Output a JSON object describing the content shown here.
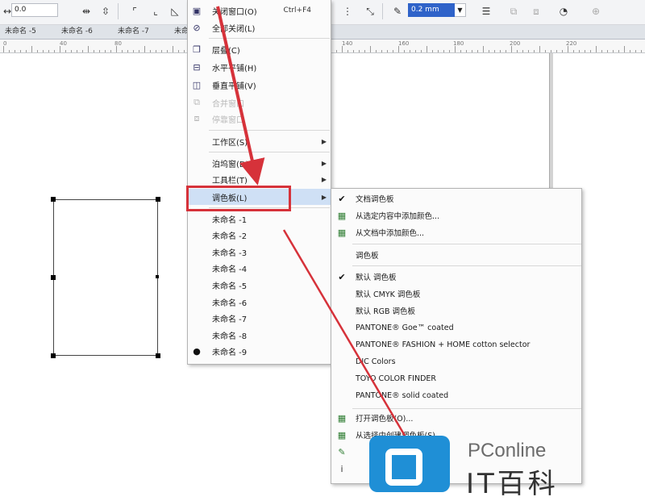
{
  "propertybar": {
    "x_value": "0.0",
    "outline_width": "0.2 mm"
  },
  "doc_tabs": [
    "未命名 -5",
    "未命名 -6",
    "未命名 -7",
    "未命名 -8"
  ],
  "ruler_numbers": [
    "0",
    "40",
    "80",
    "140",
    "160",
    "180",
    "200",
    "220"
  ],
  "window_menu": {
    "close_window": {
      "label": "关闭窗口(O)",
      "shortcut": "Ctrl+F4"
    },
    "close_all": "全部关闭(L)",
    "cascade": "层叠(C)",
    "tile_horizontal": "水平平铺(H)",
    "tile_vertical": "垂直平铺(V)",
    "disabled_1": "合并窗口",
    "disabled_2": "停靠窗口",
    "workspace": "工作区(S)",
    "dockers": "泊坞窗(D)",
    "toolbars": "工具栏(T)",
    "color_palettes": "调色板(L)",
    "documents": [
      "未命名 -1",
      "未命名 -2",
      "未命名 -3",
      "未命名 -4",
      "未命名 -5",
      "未命名 -6",
      "未命名 -7",
      "未命名 -8",
      "未命名 -9"
    ]
  },
  "palette_submenu": {
    "doc_palette": "文档调色板",
    "add_from_selection": "从选定内容中添加颜色...",
    "add_from_document": "从文档中添加颜色...",
    "palettes_header": "调色板",
    "default_palette": "默认 调色板",
    "default_cmyk": "默认 CMYK 调色板",
    "default_rgb": "默认 RGB 调色板",
    "pantone_goe": "PANTONE® Goe™ coated",
    "pantone_fashion": "PANTONE® FASHION + HOME cotton selector",
    "dic_colors": "DIC Colors",
    "toyo": "TOYO COLOR FINDER",
    "pantone_solid": "PANTONE® solid coated",
    "open_palette": "打开调色板(O)...",
    "create_from_selection": "从选择中创建调色板(S)..."
  },
  "watermark": {
    "brand": "PConline",
    "tagline": "IT百科"
  },
  "colors": {
    "highlight_red": "#d6323a",
    "selection_blue": "#2f63c9",
    "menu_hover": "#cfe0f5",
    "logo_blue": "#1f8fd6"
  }
}
